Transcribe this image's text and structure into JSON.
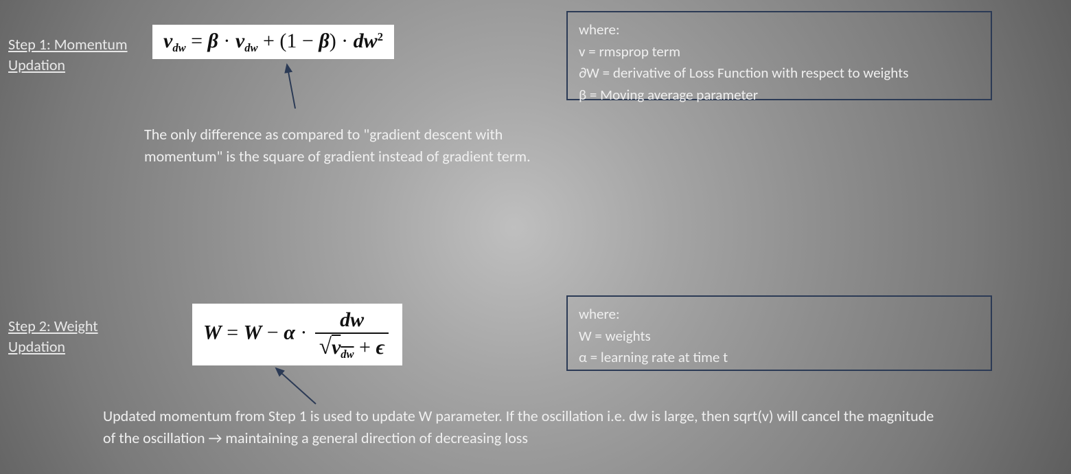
{
  "step1": {
    "title": "Step 1: Momentum Updation",
    "formula_html": "<span class='bold'>v<span class='sub'>dw</span></span> <span class='rom'>=</span> <span class='bold'>β</span> <span class='rom'>·</span> <span class='bold'>v<span class='sub'>dw</span></span> <span class='rom'>+ (1 −</span> <span class='bold'>β</span><span class='rom'>) ·</span> <span class='bold'>dw<span class='sup rom'>2</span></span>",
    "note": "The only difference as compared to \"gradient descent with momentum\" is the square of gradient instead of gradient term.",
    "legend": {
      "heading": "where:",
      "items": [
        "v = rmsprop term",
        "∂W = derivative of Loss Function with respect to weights",
        "β = Moving average parameter"
      ]
    }
  },
  "step2": {
    "title": "Step 2: Weight Updation",
    "formula_html": "<span class='bold'>W</span> <span class='rom'>=</span> <span class='bold'>W</span> <span class='rom'>−</span> <span class='bold'>α</span> <span class='rom'>·</span> <span class='frac'><span class='num'><span class='bold'>dw</span></span><span class='den'><span class='sqrt-sym'>√</span><span class='vinc'><span class='bold'>v<span class='sub'>dw</span></span></span> <span class='rom'>+</span> <span class='bold'>ϵ</span></span></span>",
    "note": "Updated momentum from Step 1 is used to update W parameter. If the oscillation i.e. dw is large, then sqrt(v) will cancel the magnitude of the oscillation → maintaining a general direction of decreasing loss",
    "legend": {
      "heading": "where:",
      "items": [
        "W = weights",
        "α = learning rate at time t"
      ]
    }
  }
}
